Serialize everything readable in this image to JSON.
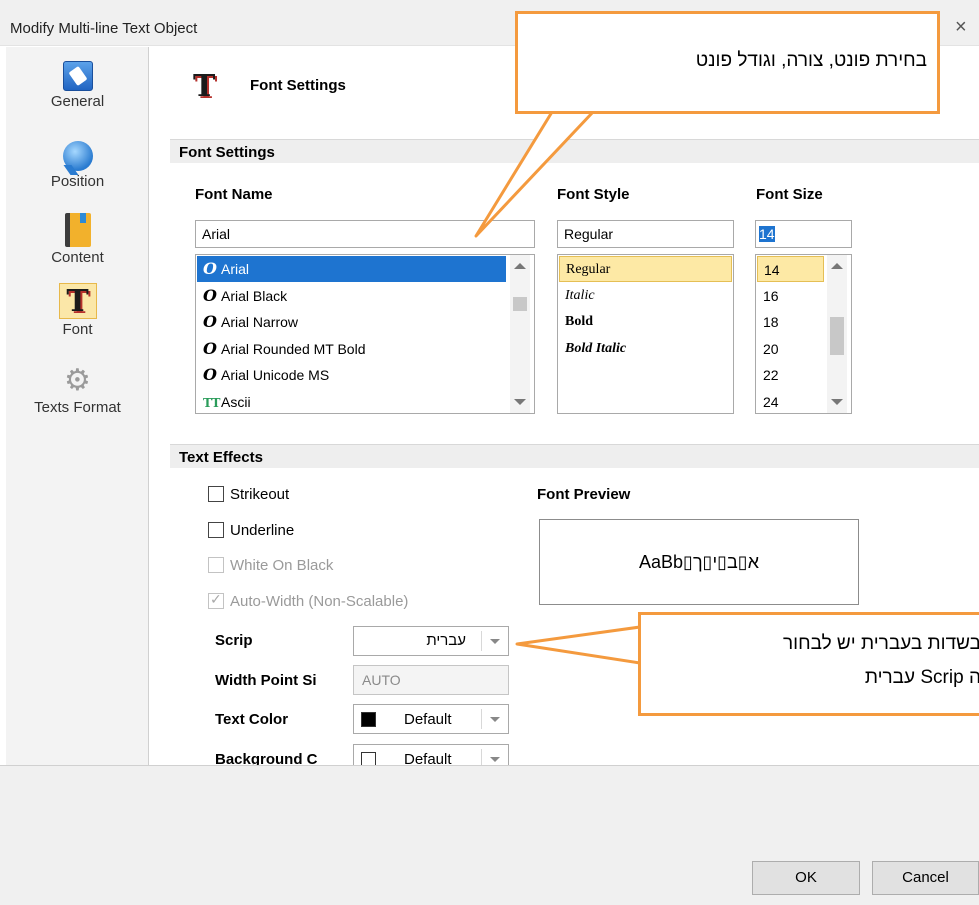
{
  "window": {
    "title": "Modify Multi-line Text Object",
    "close_glyph": "×"
  },
  "sidebar": {
    "items": [
      {
        "label": "General",
        "icon": "general-icon"
      },
      {
        "label": "Position",
        "icon": "position-icon"
      },
      {
        "label": "Content",
        "icon": "content-icon"
      },
      {
        "label": "Font",
        "icon": "font-icon",
        "selected": true
      },
      {
        "label": "Texts Format",
        "icon": "gear-icon"
      }
    ]
  },
  "header": {
    "title": "Font Settings",
    "icon_glyph": "T"
  },
  "font_settings": {
    "section_label": "Font Settings",
    "name": {
      "label": "Font Name",
      "value": "Arial",
      "options": [
        {
          "label": "Arial",
          "icon": "O",
          "selected": true
        },
        {
          "label": "Arial Black",
          "icon": "O"
        },
        {
          "label": "Arial Narrow",
          "icon": "O"
        },
        {
          "label": "Arial Rounded MT Bold",
          "icon": "O"
        },
        {
          "label": "Arial Unicode MS",
          "icon": "O"
        },
        {
          "label": "Ascii",
          "icon": "TT"
        }
      ]
    },
    "style": {
      "label": "Font Style",
      "value": "Regular",
      "options": [
        "Regular",
        "Italic",
        "Bold",
        "Bold Italic"
      ]
    },
    "size": {
      "label": "Font Size",
      "value": "14",
      "options": [
        "14",
        "16",
        "18",
        "20",
        "22",
        "24"
      ]
    }
  },
  "text_effects": {
    "section_label": "Text Effects",
    "checkboxes": [
      {
        "label": "Strikeout",
        "checked": false,
        "enabled": true
      },
      {
        "label": "Underline",
        "checked": false,
        "enabled": true
      },
      {
        "label": "White On Black",
        "checked": false,
        "enabled": false
      },
      {
        "label": "Auto-Width (Non-Scalable)",
        "checked": true,
        "enabled": false
      }
    ],
    "script": {
      "label": "Scrip",
      "value": "עברית"
    },
    "width_point_size": {
      "label": "Width Point Si",
      "value": "AUTO"
    },
    "text_color": {
      "label": "Text Color",
      "value": "Default",
      "color": "#000000"
    },
    "background_color": {
      "label": "Background C",
      "value": "Default",
      "color": "#ffffff"
    },
    "preview": {
      "label": "Font Preview",
      "sample": "AaBb▯א▯ב▯י▯ך"
    }
  },
  "buttons": {
    "ok": "OK",
    "cancel": "Cancel"
  },
  "callouts": {
    "top": "בחירת פונט, צורה, וגודל פונט",
    "bottom_line1": "בשדות בעברית יש לבחור",
    "bottom_line2": "ה Scrip עברית"
  },
  "colors": {
    "accent_orange": "#f49a3e",
    "selection_blue": "#1e74d0",
    "selection_yellow": "#fde9a5"
  }
}
